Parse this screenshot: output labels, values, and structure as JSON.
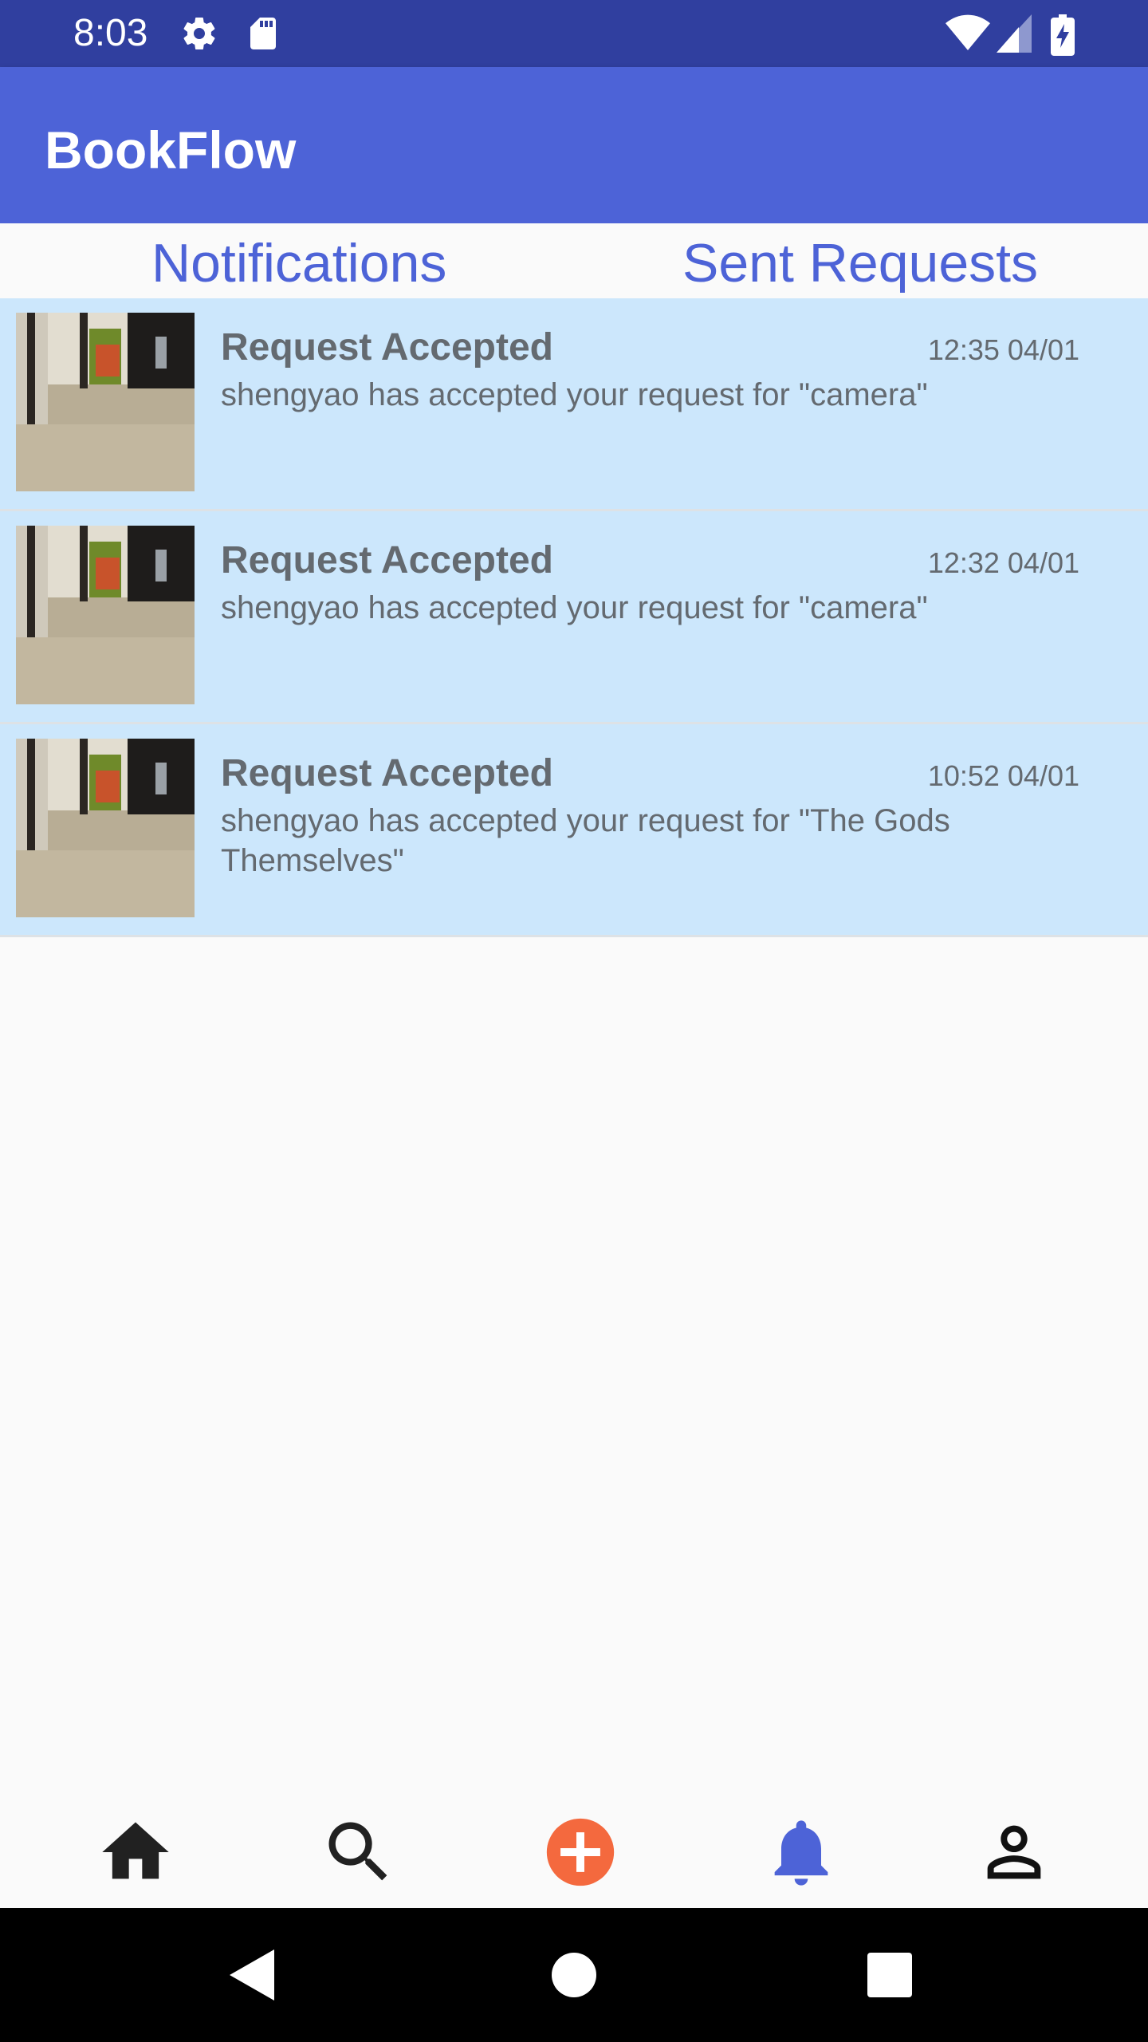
{
  "status_bar": {
    "time": "8:03",
    "icons": [
      "gear-icon",
      "sd-card-icon",
      "wifi-icon",
      "signal-icon",
      "battery-charging-icon"
    ]
  },
  "app_bar": {
    "title": "BookFlow"
  },
  "tabs": [
    {
      "label": "Notifications"
    },
    {
      "label": "Sent Requests"
    }
  ],
  "notifications": [
    {
      "title": "Request Accepted",
      "time": "12:35 04/01",
      "message": "shengyao has accepted your request for \"camera\""
    },
    {
      "title": "Request Accepted",
      "time": "12:32 04/01",
      "message": "shengyao has accepted your request for \"camera\""
    },
    {
      "title": "Request Accepted",
      "time": "10:52 04/01",
      "message": "shengyao has accepted your request for \"The Gods Themselves\""
    }
  ],
  "bottom_nav": {
    "items": [
      "home-icon",
      "search-icon",
      "add-icon",
      "notifications-bell-icon",
      "profile-icon"
    ],
    "active": "notifications-bell-icon"
  },
  "colors": {
    "status_bar": "#303f9f",
    "app_bar": "#4d63d7",
    "accent": "#4d63d7",
    "row_background": "#cce7fc",
    "add_button": "#f4693e",
    "inactive_icon": "#212121"
  }
}
